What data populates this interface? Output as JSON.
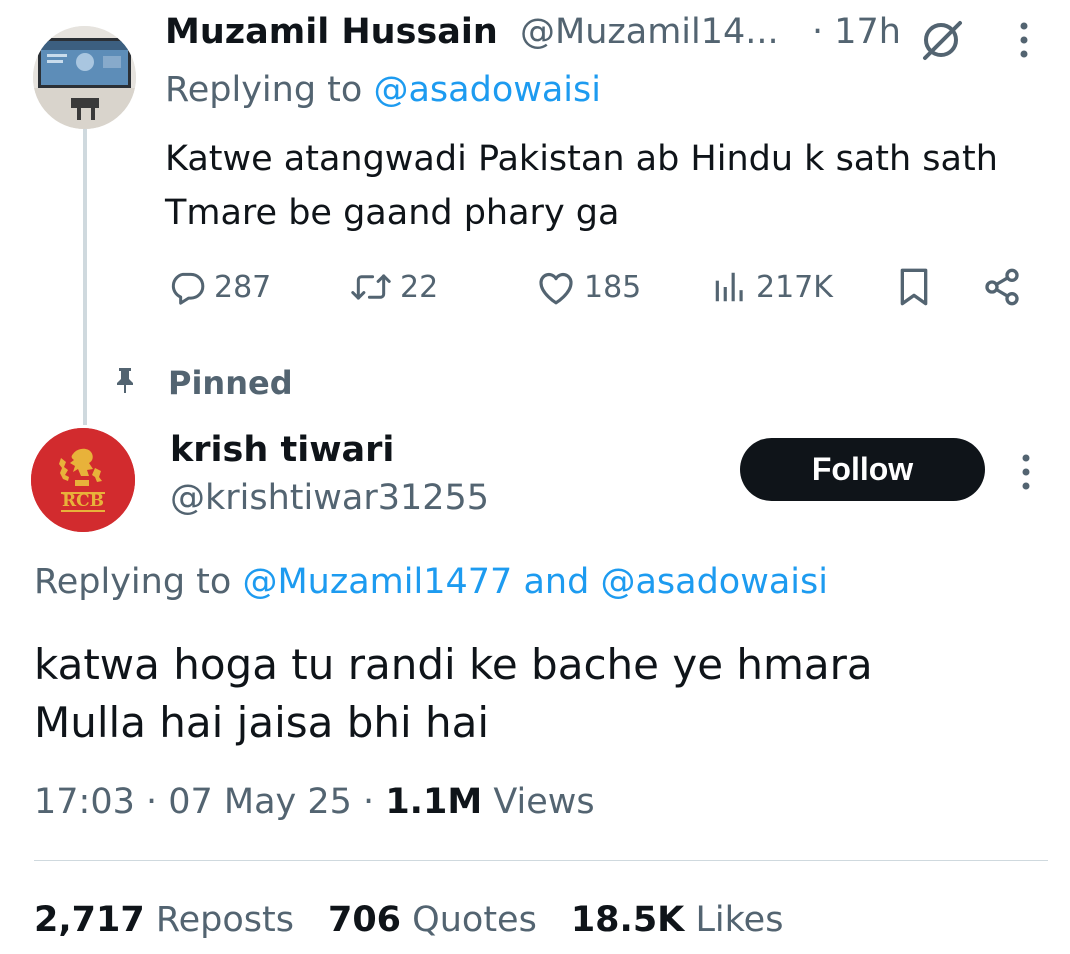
{
  "parent": {
    "name": "Muzamil Hussain",
    "handle": "@Muzamil14...",
    "time": "· 17h",
    "replying_prefix": "Replying to",
    "replying_to": "@asadowaisi",
    "text": "Katwe atangwadi Pakistan ab Hindu k sath sath Tmare be gaand phary ga",
    "actions": {
      "replies": "287",
      "reposts": "22",
      "likes": "185",
      "views": "217K"
    }
  },
  "pinned_label": "Pinned",
  "tweet": {
    "name": "krish tiwari",
    "handle": "@krishtiwar31255",
    "follow_label": "Follow",
    "replying_prefix": "Replying to",
    "replying_to_1": "@Muzamil1477",
    "replying_and": "and",
    "replying_to_2": "@asadowaisi",
    "text_line1": "katwa hoga tu randi ke bache ye hmara",
    "text_line2": "Mulla hai jaisa bhi hai",
    "time": "17:03 · 07 May 25 ·",
    "views_count": "1.1M",
    "views_label": "Views"
  },
  "stats": {
    "reposts_count": "2,717",
    "reposts_label": "Reposts",
    "quotes_count": "706",
    "quotes_label": "Quotes",
    "likes_count": "18.5K",
    "likes_label": "Likes"
  },
  "colors": {
    "link": "#1d9bf0",
    "secondary_text": "#536471",
    "primary_text": "#0f1419",
    "rcb_red": "#d22b2e",
    "rcb_gold": "#e8b23a"
  },
  "icons": {
    "grok": "grok-icon",
    "more": "more-vertical-icon",
    "reply": "reply-icon",
    "repost": "repost-icon",
    "like": "heart-icon",
    "views": "views-icon",
    "bookmark": "bookmark-icon",
    "share": "share-icon",
    "pin": "pin-icon"
  }
}
